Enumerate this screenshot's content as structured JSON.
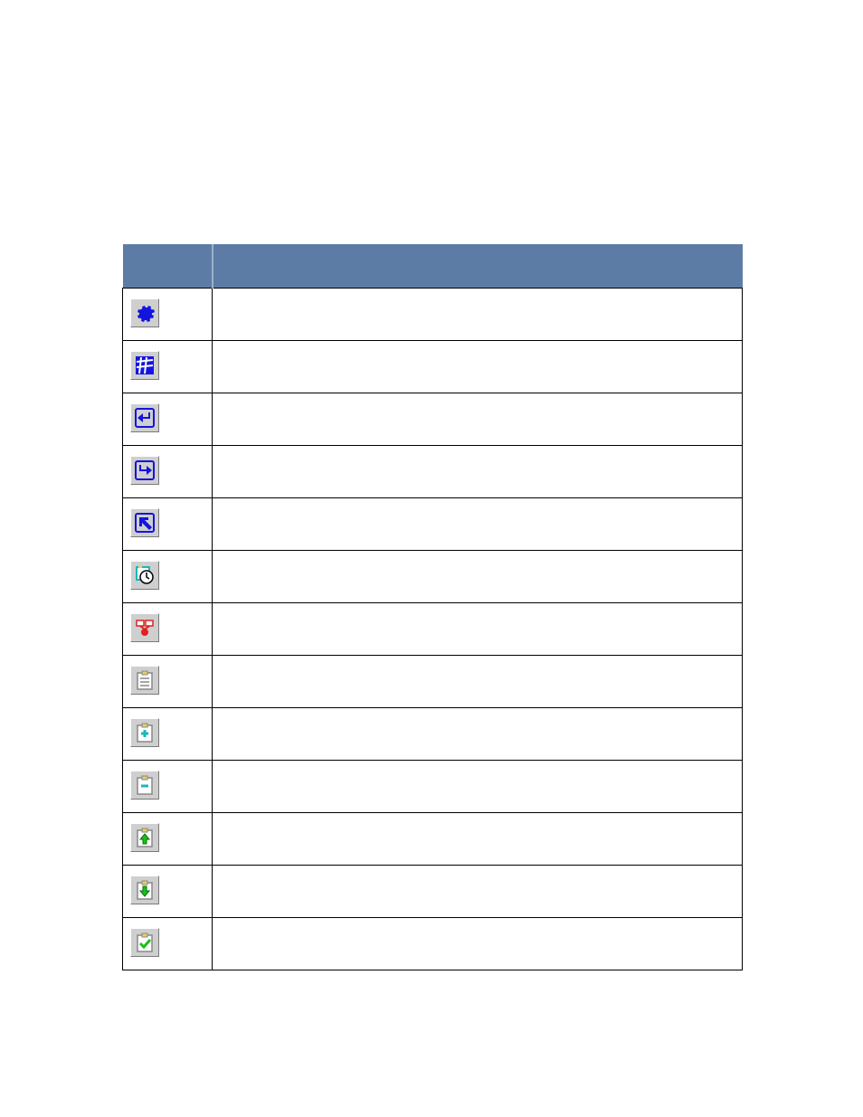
{
  "table": {
    "headers": {
      "icon": "",
      "desc": ""
    },
    "rows": [
      {
        "icon": "gear-icon",
        "desc": ""
      },
      {
        "icon": "grid-lines-icon",
        "desc": ""
      },
      {
        "icon": "arrow-left-icon",
        "desc": ""
      },
      {
        "icon": "arrow-right-icon",
        "desc": ""
      },
      {
        "icon": "edit-arrow-icon",
        "desc": ""
      },
      {
        "icon": "clock-icon",
        "desc": ""
      },
      {
        "icon": "conflict-icon",
        "desc": ""
      },
      {
        "icon": "clipboard-icon",
        "desc": ""
      },
      {
        "icon": "clipboard-plus-icon",
        "desc": ""
      },
      {
        "icon": "clipboard-minus-icon",
        "desc": ""
      },
      {
        "icon": "clipboard-up-icon",
        "desc": ""
      },
      {
        "icon": "clipboard-down-icon",
        "desc": ""
      },
      {
        "icon": "clipboard-check-icon",
        "desc": ""
      }
    ]
  }
}
